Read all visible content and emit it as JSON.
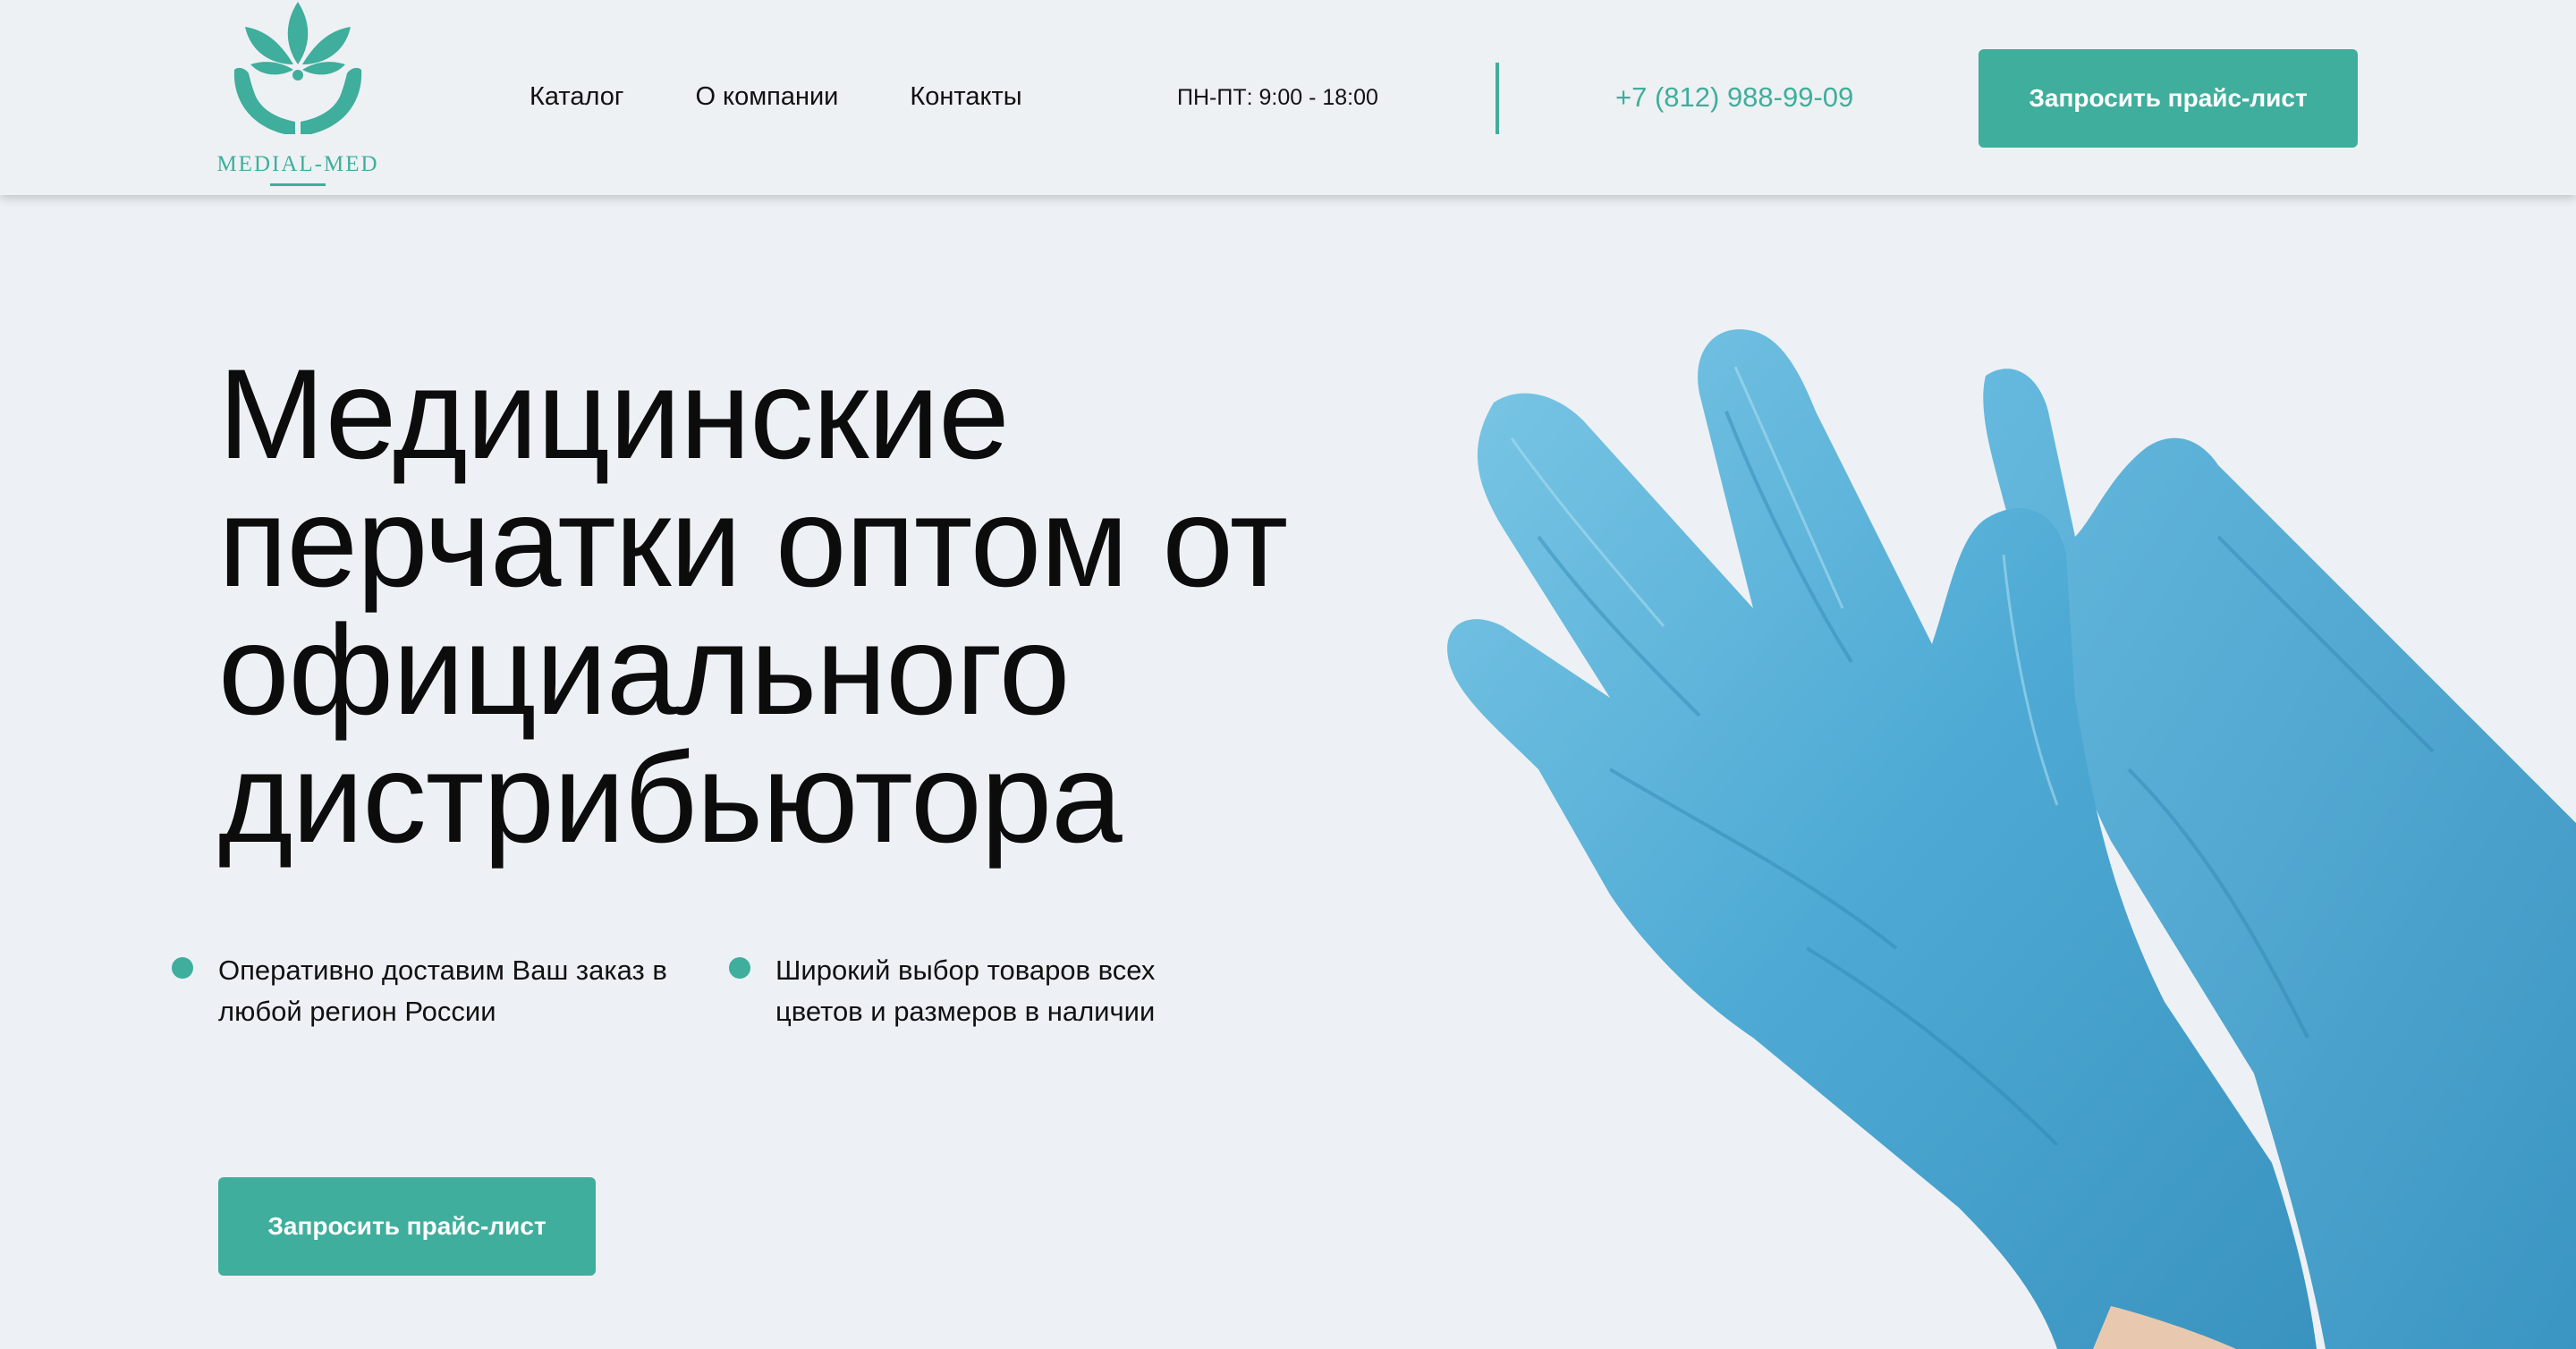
{
  "brand": {
    "name": "MEDIAL-MED",
    "logo_icon": "leaf-hands-logo-icon",
    "accent_color": "#3fae9c"
  },
  "nav": {
    "items": [
      {
        "label": "Каталог"
      },
      {
        "label": "О компании"
      },
      {
        "label": "Контакты"
      }
    ]
  },
  "header": {
    "hours": "ПН-ПТ: 9:00 - 18:00",
    "phone": "+7 (812) 988-99-09",
    "cta_label": "Запросить прайс-лист"
  },
  "hero": {
    "title_lines": [
      "Медицинские",
      "перчатки оптом от",
      "официального",
      "дистрибьютора"
    ],
    "features": [
      {
        "line1": "Оперативно доставим Ваш заказ в",
        "line2": "любой регион России"
      },
      {
        "line1": "Широкий выбор товаров всех",
        "line2": "цветов и размеров в наличии"
      }
    ],
    "cta_label": "Запросить прайс-лист",
    "image": "blue-medical-gloves-photo"
  }
}
